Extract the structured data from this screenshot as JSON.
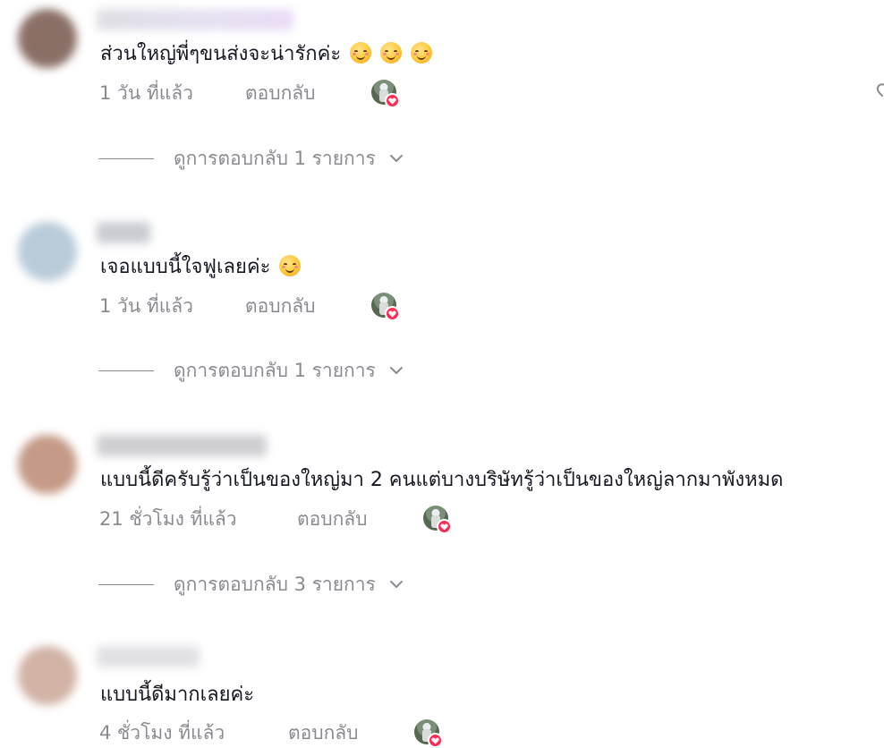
{
  "comments": [
    {
      "text": "ส่วนใหญ่พี่ๆขนส่งจะน่ารักค่ะ",
      "emoji_count": 3,
      "emoji": "smiling-face-with-smiling-eyes",
      "time": "1 วัน ที่แล้ว",
      "reply_label": "ตอบกลับ",
      "view_replies_label": "ดูการตอบกลับ 1 รายการ",
      "avatar_color": "#8a6f66",
      "username_color": "#e6dcf3"
    },
    {
      "text": "เจอแบบนี้ใจฟูเลยค่ะ",
      "emoji_count": 1,
      "emoji": "smiling-face-with-smiling-eyes",
      "time": "1 วัน ที่แล้ว",
      "reply_label": "ตอบกลับ",
      "view_replies_label": "ดูการตอบกลับ 1 รายการ",
      "avatar_color": "#b9cbd9",
      "username_color": "#c9ccd2"
    },
    {
      "text": "แบบนี้ดีครับรู้ว่าเป็นของใหญ่มา 2 คนแต่บางบริษัทรู้ว่าเป็นของใหญ่ลากมาพังหมด",
      "emoji_count": 0,
      "emoji": "",
      "time": "21 ชั่วโมง ที่แล้ว",
      "reply_label": "ตอบกลับ",
      "view_replies_label": "ดูการตอบกลับ 3 รายการ",
      "avatar_color": "#c59a86",
      "username_color": "#cfcfd3"
    },
    {
      "text": "แบบนี้ดีมากเลยค่ะ",
      "emoji_count": 0,
      "emoji": "",
      "time": "4 ชั่วโมง ที่แล้ว",
      "reply_label": "ตอบกลับ",
      "view_replies_label": "",
      "avatar_color": "#d2b3a6",
      "username_color": "#e1e1e5"
    }
  ],
  "icons": {
    "creator_liked": "creator-avatar-heart-icon",
    "expand": "chevron-down-icon",
    "edge": "heart-outline-icon"
  },
  "colors": {
    "text": "#161823",
    "muted": "#8a8b91",
    "like_badge": "#fe2c55"
  }
}
